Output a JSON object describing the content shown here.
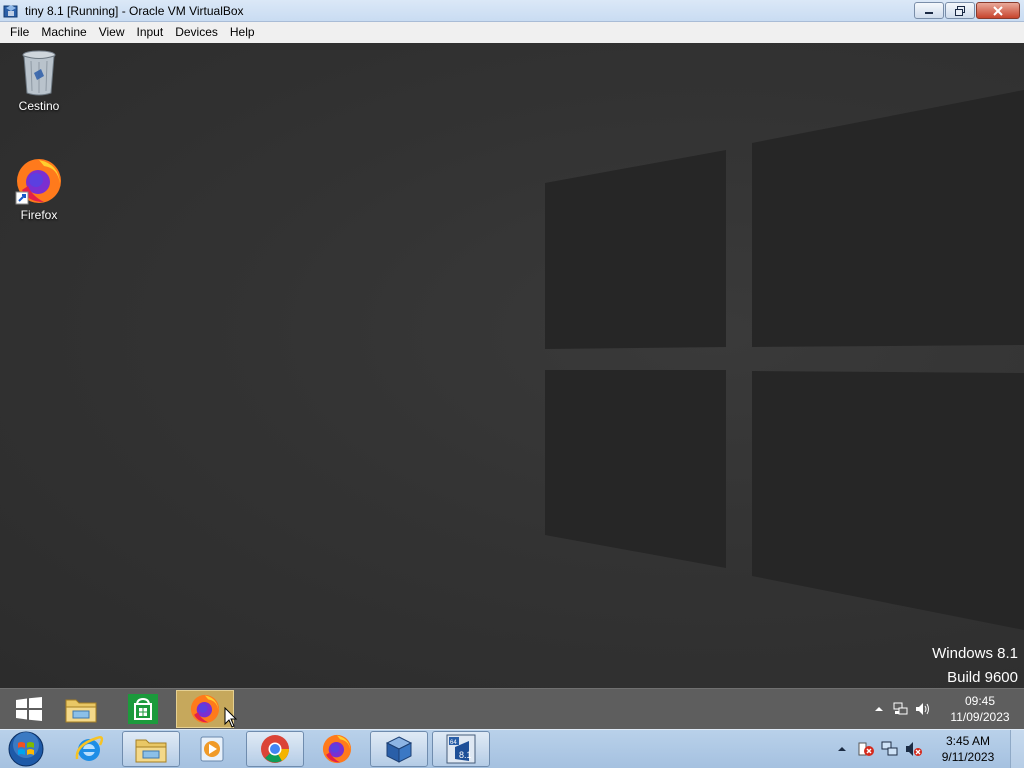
{
  "window": {
    "title": "tiny 8.1 [Running] - Oracle VM VirtualBox",
    "icon": "virtualbox-icon"
  },
  "menubar": {
    "items": [
      {
        "label": "File"
      },
      {
        "label": "Machine"
      },
      {
        "label": "View"
      },
      {
        "label": "Input"
      },
      {
        "label": "Devices"
      },
      {
        "label": "Help"
      }
    ]
  },
  "desktop": {
    "icons": [
      {
        "label": "Cestino",
        "icon": "recycle-bin-icon"
      },
      {
        "label": "Firefox",
        "icon": "firefox-icon"
      }
    ],
    "watermark": {
      "line1": "Windows 8.1",
      "line2": "Build 9600"
    }
  },
  "guest_taskbar": {
    "pinned": [
      {
        "icon": "windows-start-icon"
      },
      {
        "icon": "file-explorer-icon"
      },
      {
        "icon": "store-icon"
      },
      {
        "icon": "firefox-icon",
        "active": true
      }
    ],
    "tray": [
      "chevron-up-icon",
      "network-icon",
      "volume-icon"
    ],
    "clock": {
      "time": "09:45",
      "date": "11/09/2023"
    }
  },
  "host_taskbar": {
    "pinned": [
      {
        "icon": "windows7-start-orb-icon"
      },
      {
        "icon": "internet-explorer-icon"
      },
      {
        "icon": "windows-explorer-icon"
      },
      {
        "icon": "media-player-icon"
      },
      {
        "icon": "chrome-icon"
      },
      {
        "icon": "firefox-icon"
      },
      {
        "icon": "virtualbox-icon"
      },
      {
        "icon": "tiny81-vm-icon"
      }
    ],
    "tray": [
      "chevron-up-icon",
      "action-center-error-icon",
      "network-icon",
      "volume-muted-icon"
    ],
    "clock": {
      "time": "3:45 AM",
      "date": "9/11/2023"
    }
  },
  "colors": {
    "desktop_bg": "#333333",
    "guest_taskbar": "#5e5e5e",
    "active_button": "#c6a85c",
    "host_taskbar": "#b4cde8"
  }
}
